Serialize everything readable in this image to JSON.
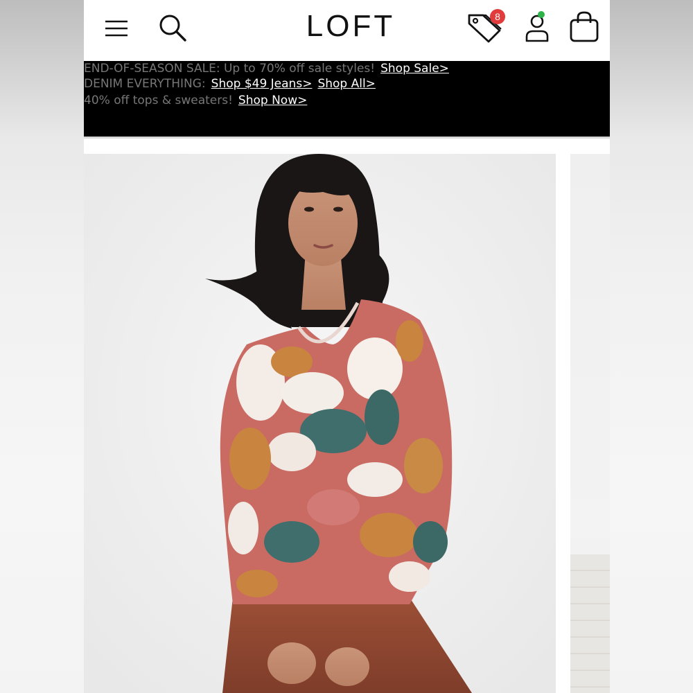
{
  "header": {
    "logo": "LOFT",
    "menu_icon": "menu-icon",
    "search_icon": "search-icon",
    "offers_icon": "price-tags-icon",
    "offers_badge_count": "8",
    "account_icon": "account-icon",
    "bag_icon": "shopping-bag-icon"
  },
  "promo": {
    "line1": {
      "text": "END-OF-SEASON SALE: Up to 70% off sale styles!",
      "links": [
        "Shop Sale>"
      ]
    },
    "line2": {
      "text": "DENIM EVERYTHING:",
      "links": [
        "Shop $49 Jeans>",
        "Shop All>"
      ]
    },
    "line3": {
      "text": "40% off tops & sweaters!",
      "links": [
        "Shop Now>"
      ]
    }
  },
  "colors": {
    "badge": "#e23b3b",
    "online_dot": "#2db34a",
    "banner_bg": "#000000",
    "banner_text": "#777777",
    "link_text": "#ffffff"
  }
}
